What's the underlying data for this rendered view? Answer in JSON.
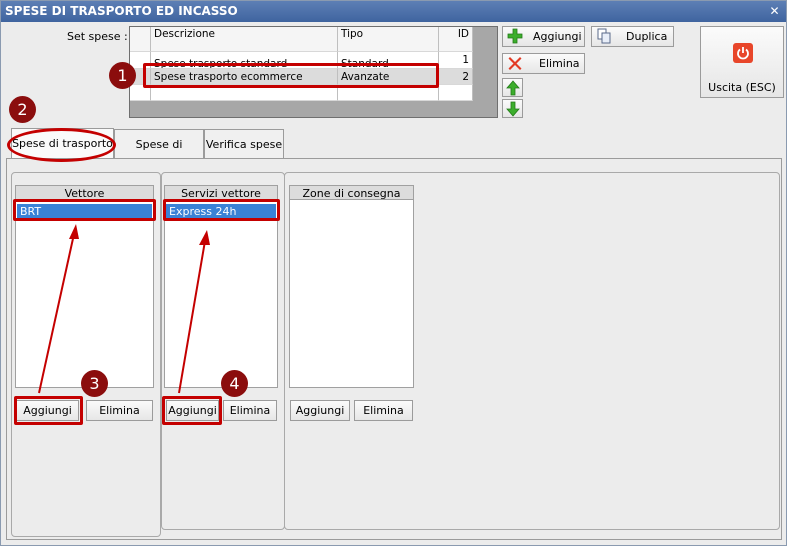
{
  "window": {
    "title": "SPESE DI TRASPORTO ED INCASSO",
    "close_glyph": "✕"
  },
  "set_spese": {
    "label": "Set spese :",
    "columns": [
      "Descrizione",
      "Tipo",
      "ID"
    ],
    "rows": [
      {
        "descrizione": "Spese trasporto standard",
        "tipo": "Standard",
        "id": "1"
      },
      {
        "descrizione": "Spese trasporto ecommerce",
        "tipo": "Avanzate",
        "id": "2"
      }
    ]
  },
  "toolbar": {
    "aggiungi": "Aggiungi",
    "elimina": "Elimina",
    "duplica": "Duplica",
    "uscita": "Uscita (ESC)"
  },
  "tabs": [
    "Spese di trasporto",
    "Spese di incasso",
    "Verifica spese"
  ],
  "lists": {
    "vettore": {
      "header": "Vettore",
      "items": [
        "BRT"
      ],
      "add": "Aggiungi",
      "remove": "Elimina"
    },
    "servizi": {
      "header": "Servizi vettore",
      "items": [
        "Express 24h"
      ],
      "add": "Aggiungi",
      "remove": "Elimina"
    },
    "zone": {
      "header": "Zone di consegna",
      "items": [],
      "add": "Aggiungi",
      "remove": "Elimina"
    }
  },
  "annotations": [
    "1",
    "2",
    "3",
    "4"
  ],
  "colors": {
    "annotation_red": "#c40000",
    "badge": "#8b0d0d",
    "selection": "#3a82d6"
  },
  "icons": [
    "close-icon",
    "plus-icon",
    "delete-icon",
    "copy-icon",
    "power-icon",
    "arrow-up-icon",
    "arrow-down-icon"
  ]
}
